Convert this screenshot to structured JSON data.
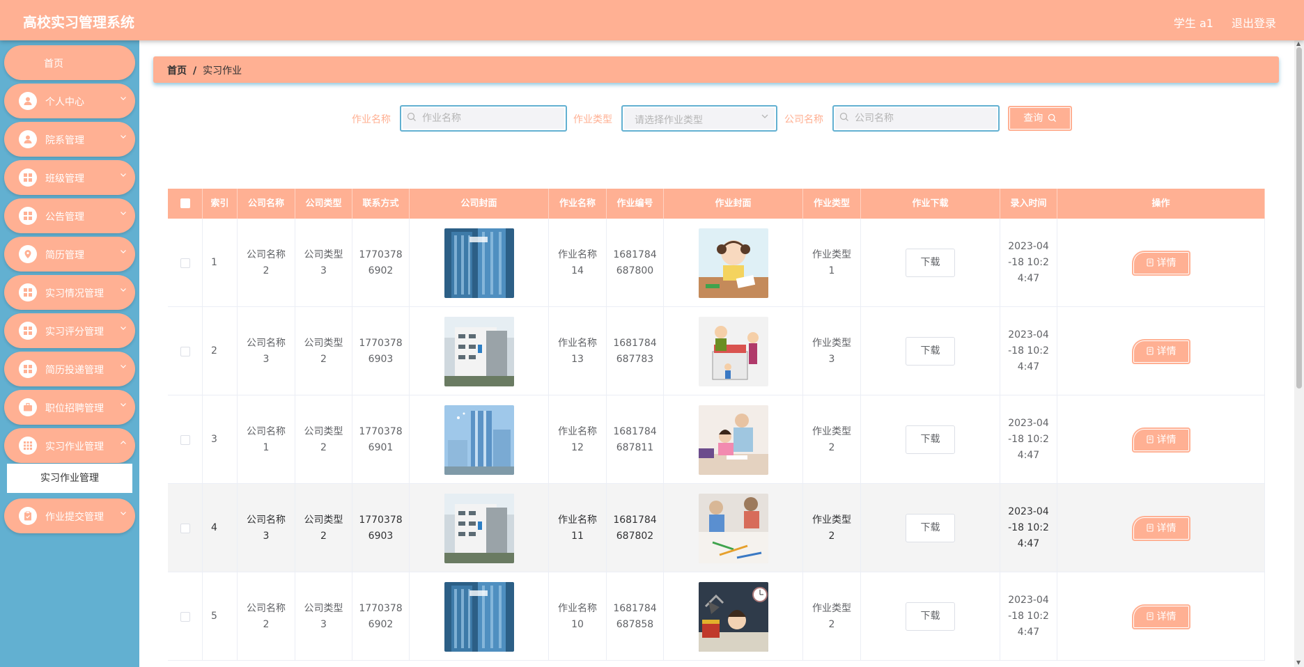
{
  "header": {
    "title": "高校实习管理系统",
    "user": "学生 a1",
    "logout": "退出登录"
  },
  "sidebar": {
    "items": [
      {
        "label": "首页",
        "icon": "home",
        "chevron": false
      },
      {
        "label": "个人中心",
        "icon": "user-icon",
        "chevron": true
      },
      {
        "label": "院系管理",
        "icon": "user-icon",
        "chevron": true
      },
      {
        "label": "班级管理",
        "icon": "grid-icon",
        "chevron": true
      },
      {
        "label": "公告管理",
        "icon": "grid-icon",
        "chevron": true
      },
      {
        "label": "简历管理",
        "icon": "location-icon",
        "chevron": true
      },
      {
        "label": "实习情况管理",
        "icon": "grid-icon",
        "chevron": true
      },
      {
        "label": "实习评分管理",
        "icon": "grid-icon",
        "chevron": true
      },
      {
        "label": "简历投递管理",
        "icon": "grid-icon",
        "chevron": true
      },
      {
        "label": "职位招聘管理",
        "icon": "briefcase-icon",
        "chevron": true
      },
      {
        "label": "实习作业管理",
        "icon": "apps-icon",
        "chevron": true,
        "expanded": true
      },
      {
        "label": "作业提交管理",
        "icon": "clipboard-icon",
        "chevron": true
      }
    ],
    "submenu": "实习作业管理"
  },
  "breadcrumb": {
    "home": "首页",
    "sep": "/",
    "current": "实习作业"
  },
  "search": {
    "name_label": "作业名称",
    "name_placeholder": "作业名称",
    "type_label": "作业类型",
    "type_placeholder": "请选择作业类型",
    "company_label": "公司名称",
    "company_placeholder": "公司名称",
    "query_label": "查询"
  },
  "table": {
    "headers": [
      "索引",
      "公司名称",
      "公司类型",
      "联系方式",
      "公司封面",
      "作业名称",
      "作业编号",
      "作业封面",
      "作业类型",
      "作业下载",
      "录入时间",
      "操作"
    ],
    "download_label": "下载",
    "detail_label": "详情",
    "rows": [
      {
        "index": "1",
        "company": "公司名称\n2",
        "ctype": "公司类型\n3",
        "phone": "1770378\n6902",
        "cover": "office-tower-blue",
        "hw_name": "作业名称\n14",
        "hw_no": "1681784\n687800",
        "hw_cover": "cartoon-girl-studying",
        "hw_type": "作业类型\n1",
        "time": "2023-04\n-18 10:2\n4:47"
      },
      {
        "index": "2",
        "company": "公司名称\n3",
        "ctype": "公司类型\n2",
        "phone": "1770378\n6903",
        "cover": "office-building-white",
        "hw_name": "作业名称\n13",
        "hw_no": "1681784\n687783",
        "hw_cover": "cartoon-homework-pile",
        "hw_type": "作业类型\n3",
        "time": "2023-04\n-18 10:2\n4:47"
      },
      {
        "index": "3",
        "company": "公司名称\n1",
        "ctype": "公司类型\n2",
        "phone": "1770378\n6901",
        "cover": "glass-skyscraper",
        "hw_name": "作业名称\n12",
        "hw_no": "1681784\n687811",
        "hw_cover": "parent-tutoring-child",
        "hw_type": "作业类型\n2",
        "time": "2023-04\n-18 10:2\n4:47"
      },
      {
        "index": "4",
        "company": "公司名称\n3",
        "ctype": "公司类型\n2",
        "phone": "1770378\n6903",
        "cover": "office-building-white",
        "hw_name": "作业名称\n11",
        "hw_no": "1681784\n687802",
        "hw_cover": "kids-drawing",
        "hw_type": "作业类型\n2",
        "time": "2023-04\n-18 10:2\n4:47"
      },
      {
        "index": "5",
        "company": "公司名称\n2",
        "ctype": "公司类型\n3",
        "phone": "1770378\n6902",
        "cover": "office-tower-blue",
        "hw_name": "作业名称\n10",
        "hw_no": "1681784\n687858",
        "hw_cover": "cartoon-tired-student",
        "hw_type": "作业类型\n2",
        "time": "2023-04\n-18 10:2\n4:47"
      }
    ]
  },
  "colors": {
    "primary": "#ffb093",
    "sidebar": "#62b0d1"
  }
}
